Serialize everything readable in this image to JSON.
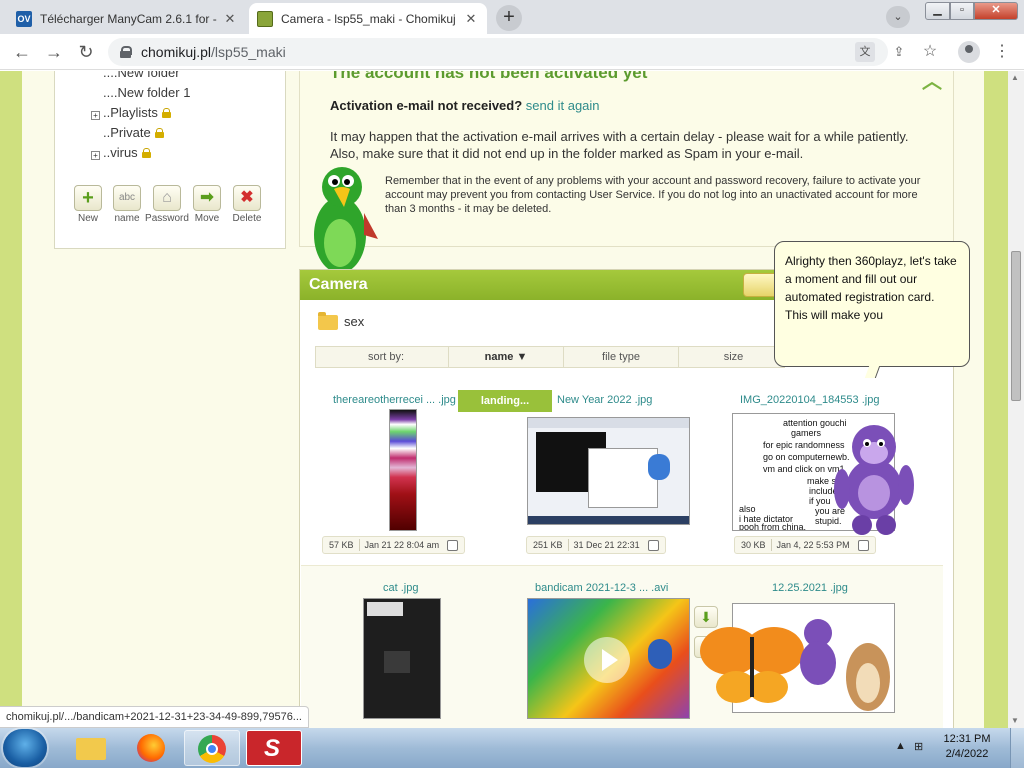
{
  "browser": {
    "tabs": [
      {
        "title": "Télécharger ManyCam 2.6.1 for -",
        "favicon": "OV",
        "favicon_color": "#1f5fa8"
      },
      {
        "title": "Camera - lsp55_maki - Chomikuj",
        "favicon": "",
        "favicon_color": "#7a9b2a"
      }
    ],
    "address": {
      "host": "chomikuj.pl",
      "path": "/lsp55_maki"
    },
    "status_url": "chomikuj.pl/.../bandicam+2021-12-31+23-34-49-899,79576..."
  },
  "tree": {
    "items": [
      {
        "label": "New folder",
        "locked": false,
        "expandable": false
      },
      {
        "label": "New folder 1",
        "locked": false,
        "expandable": false
      },
      {
        "label": "Playlists",
        "locked": true,
        "expandable": true
      },
      {
        "label": "Private",
        "locked": true,
        "expandable": false
      },
      {
        "label": "virus",
        "locked": true,
        "expandable": true
      }
    ],
    "buttons": [
      {
        "label": "New",
        "icon": "+",
        "color": "#5a9e1c"
      },
      {
        "label": "name",
        "icon": "abc",
        "color": "#888"
      },
      {
        "label": "Password",
        "icon": "lock",
        "color": "#888"
      },
      {
        "label": "Move",
        "icon": "arrow",
        "color": "#5a9e1c"
      },
      {
        "label": "Delete",
        "icon": "x",
        "color": "#d32f2f"
      }
    ]
  },
  "notice": {
    "title": "The account has not been activated yet",
    "question": "Activation e-mail not received?",
    "send_link": "send it again",
    "paragraph1": "It may happen that the activation e-mail arrives with a certain delay - please wait for a while patiently. Also, make sure that it did not end up in the folder marked as Spam in your e-mail.",
    "paragraph2": "Remember that in the event of any problems with your account and password recovery, failure to activate your account may prevent you from contacting User Service. If you do not log into an unactivated account for more than 3 months - it may be deleted."
  },
  "camera": {
    "title": "Camera",
    "folder": "sex",
    "sort_label": "sort by:",
    "sort_columns": [
      "name ▼",
      "file type",
      "size"
    ],
    "loading": "landing...",
    "files": [
      {
        "name": "thereareotherrecei ... .jpg",
        "size": "57 KB",
        "date": "Jan 21 22 8:04 am"
      },
      {
        "name": "New Year 2022 .jpg",
        "size": "251 KB",
        "date": "31 Dec 21 22:31"
      },
      {
        "name": "IMG_20220104_184553 .jpg",
        "size": "30 KB",
        "date": "Jan 4, 22 5:53 PM"
      },
      {
        "name": "cat .jpg"
      },
      {
        "name": "bandicam 2021-12-3 ... .avi"
      },
      {
        "name": "12.25.2021 .jpg"
      }
    ],
    "meme_text": [
      "attention gouchi",
      "gamers",
      "for epic randomness",
      "go on computernewb.",
      "vm and click on vm1",
      "make sure",
      "include",
      "if you",
      "also",
      "i hate dictator",
      "pooh from china.",
      "you are",
      "stupid."
    ]
  },
  "bonzi": {
    "bubble": "Alrighty then 360playz, let's take a moment and fill out our automated registration card. This will make you"
  },
  "taskbar": {
    "time": "12:31 PM",
    "date": "2/4/2022"
  }
}
